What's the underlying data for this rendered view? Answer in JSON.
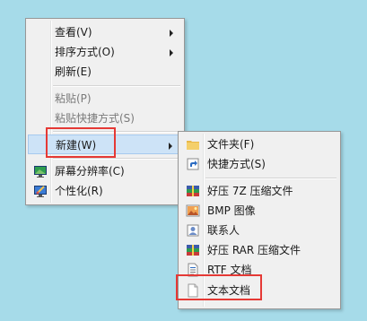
{
  "main_menu": {
    "items": [
      {
        "label": "查看(V)",
        "has_submenu": true
      },
      {
        "label": "排序方式(O)",
        "has_submenu": true
      },
      {
        "label": "刷新(E)"
      },
      {
        "label": "粘贴(P)",
        "disabled": true
      },
      {
        "label": "粘贴快捷方式(S)",
        "disabled": true
      },
      {
        "label": "新建(W)",
        "has_submenu": true,
        "hovered": true
      },
      {
        "label": "屏幕分辨率(C)",
        "icon": "display-icon"
      },
      {
        "label": "个性化(R)",
        "icon": "personalize-icon"
      }
    ]
  },
  "sub_menu": {
    "items": [
      {
        "label": "文件夹(F)",
        "icon": "folder-icon"
      },
      {
        "label": "快捷方式(S)",
        "icon": "shortcut-icon"
      },
      {
        "label": "好压 7Z 压缩文件",
        "icon": "archive-7z-icon"
      },
      {
        "label": "BMP 图像",
        "icon": "bmp-image-icon"
      },
      {
        "label": "联系人",
        "icon": "contact-icon"
      },
      {
        "label": "好压 RAR 压缩文件",
        "icon": "archive-rar-icon"
      },
      {
        "label": "RTF 文档",
        "icon": "rtf-document-icon"
      },
      {
        "label": "文本文档",
        "icon": "text-document-icon"
      }
    ]
  },
  "colors": {
    "desktop": "#a6dbe9",
    "highlight_box": "#e53935",
    "hover": "#cde3f7"
  }
}
